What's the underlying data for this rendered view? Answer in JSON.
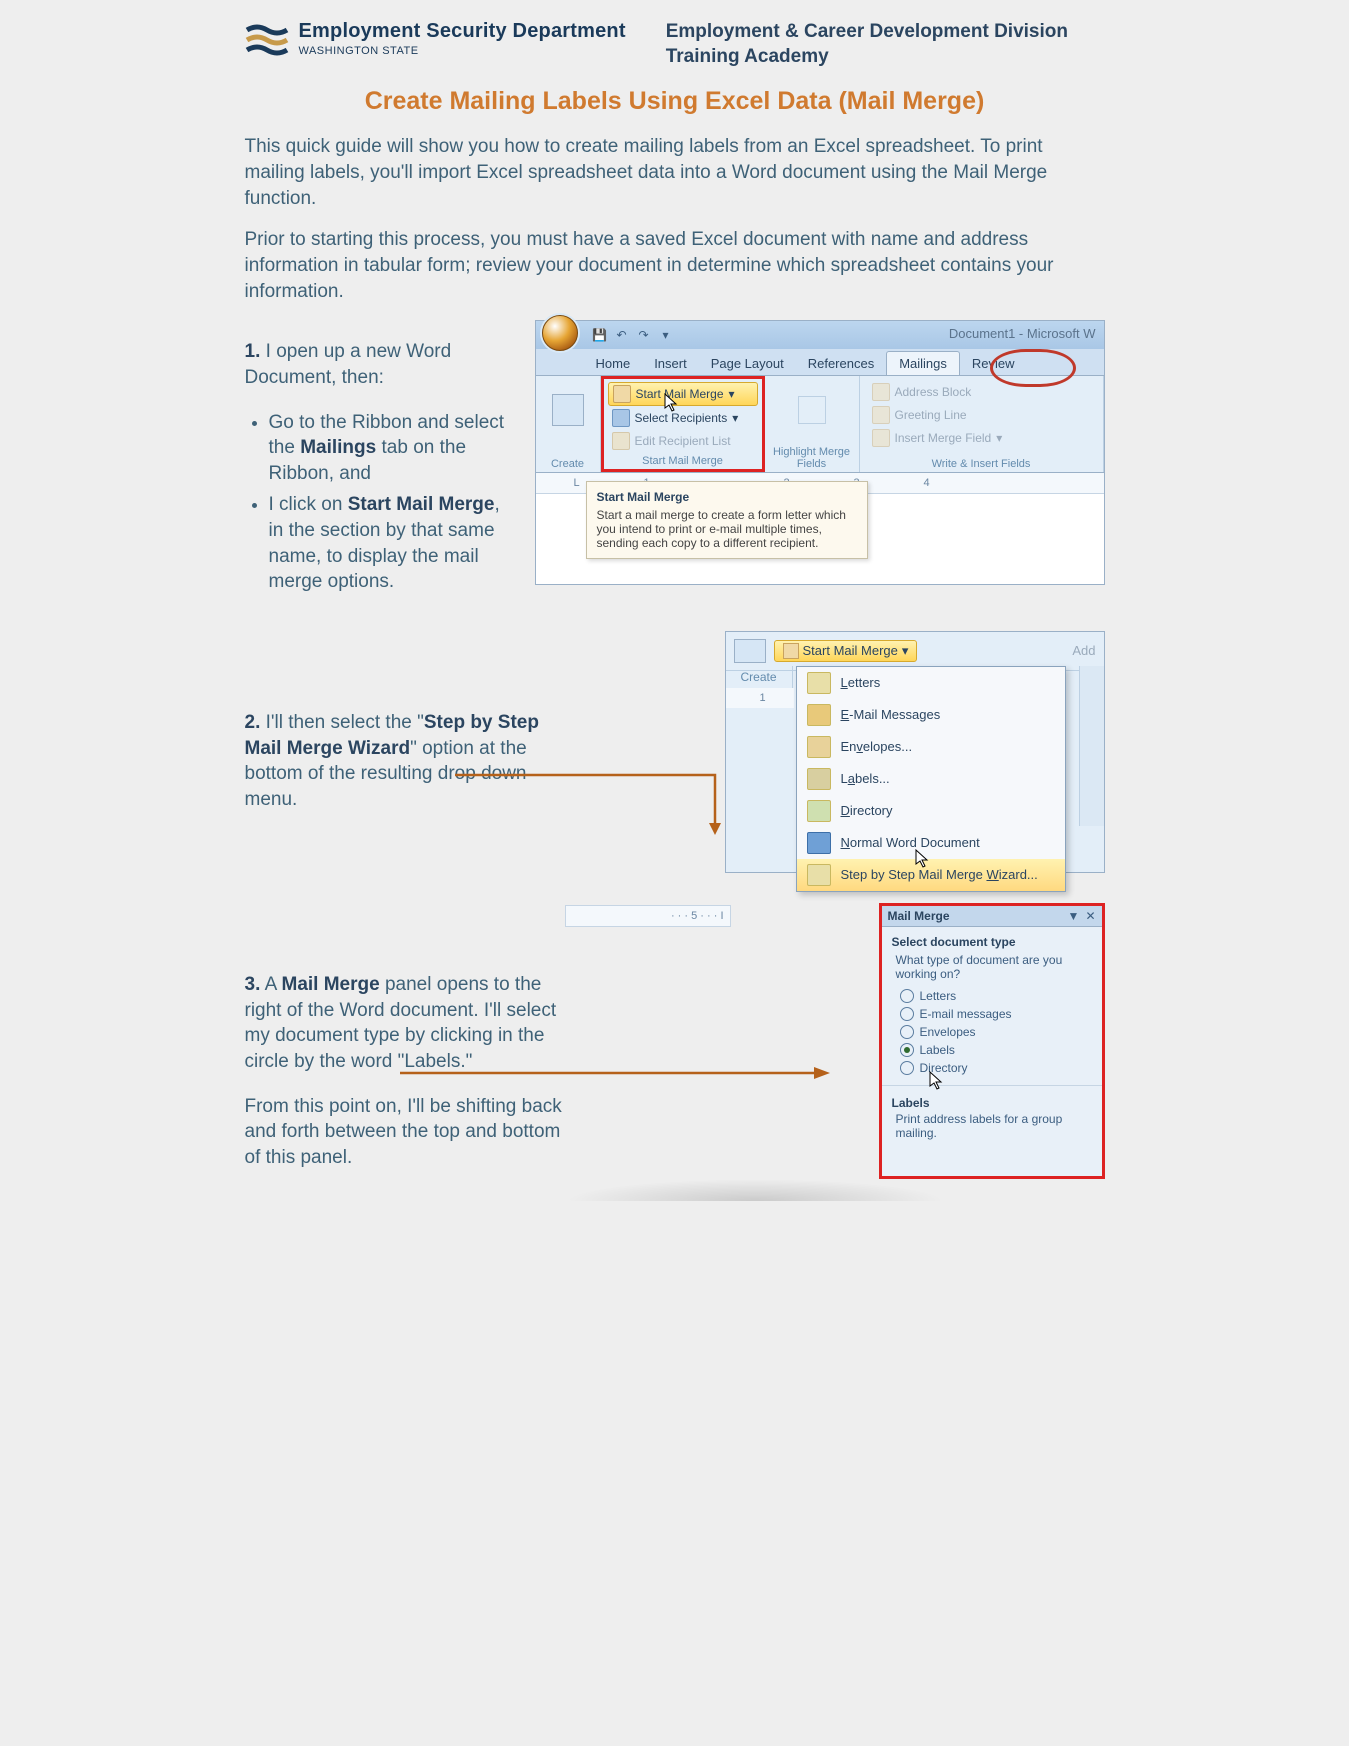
{
  "header": {
    "dept": "Employment Security Department",
    "state": "WASHINGTON STATE",
    "division_l1": "Employment & Career Development Division",
    "division_l2": "Training Academy"
  },
  "title": "Create Mailing Labels Using Excel Data (Mail Merge)",
  "intro1": "This quick guide will show you how to create mailing labels from an Excel spreadsheet. To print mailing labels, you'll import Excel spreadsheet data into a Word document using the Mail Merge function.",
  "intro2": "Prior to starting this process, you must have a saved Excel document with name and address information in tabular form; review your document in determine which spreadsheet contains your information.",
  "step1": {
    "num": "1.",
    "lead": "  I open up a new Word Document, then:",
    "b1a": "Go to the Ribbon and select the ",
    "b1b": "Mailings",
    "b1c": " tab on the Ribbon, and",
    "b2a": "I click on ",
    "b2b": "Start Mail Merge",
    "b2c": ", in the section by that same name, to display the mail merge options."
  },
  "shot1": {
    "wintitle": "Document1 - Microsoft W",
    "tabs": {
      "home": "Home",
      "insert": "Insert",
      "pagelayout": "Page Layout",
      "references": "References",
      "mailings": "Mailings",
      "review": "Review"
    },
    "create": "Create",
    "groupMerge": "Start Mail Merge",
    "btn_smm": "Start Mail Merge",
    "btn_sel": "Select Recipients",
    "btn_edit": "Edit Recipient List",
    "highlight": "Highlight Merge Fields",
    "addr": "Address Block",
    "greet": "Greeting Line",
    "imf": "Insert Merge Field",
    "groupWrite": "Write & Insert Fields",
    "tip_t": "Start Mail Merge",
    "tip_b": "Start a mail merge to create a form letter which you intend to print or e-mail multiple times, sending each copy to a different recipient.",
    "r1": "1",
    "r2": "2",
    "r3": "3",
    "r4": "4"
  },
  "step2": {
    "num": "2.",
    "a": " I'll then select the \"",
    "b": "Step by Step Mail Merge Wizard",
    "c": "\" option at the bottom of the resulting drop down menu."
  },
  "shot2": {
    "smm": "Start Mail Merge",
    "add": "Add",
    "create": "Create",
    "m1": "Letters",
    "m2": "E-Mail Messages",
    "m3": "Envelopes...",
    "m4": "Labels...",
    "m5": "Directory",
    "m6": "Normal Word Document",
    "m7": "Step by Step Mail Merge Wizard...",
    "r": "1"
  },
  "step3": {
    "num": "3.",
    "a": " A ",
    "b": "Mail Merge",
    "c": " panel opens to the right of the Word document. I'll select my document type by clicking in the circle by the word \"Labels.\"",
    "d": "From this point on, I'll be shifting back and forth between the top and bottom of this panel."
  },
  "shot3": {
    "title": "Mail Merge",
    "sec": "Select document type",
    "q": "What type of document are you working on?",
    "o1": "Letters",
    "o2": "E-mail messages",
    "o3": "Envelopes",
    "o4": "Labels",
    "o5": "Directory",
    "lbl": "Labels",
    "desc": "Print address labels for a group mailing.",
    "ruler": "· · · 5 · · · I"
  }
}
